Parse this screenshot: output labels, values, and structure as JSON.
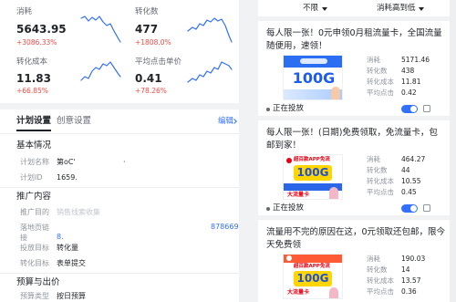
{
  "colors": {
    "accent": "#3370ff",
    "increase": "#f54a45",
    "toggle_on": "#3370ff",
    "status_dot": "#646a73"
  },
  "icons": {
    "sort_caret": "caret-down-icon",
    "edit_chevron": "chevron-right-icon",
    "card_action": "copy-icon",
    "carrier_logo": "unicom-logo-icon"
  },
  "metrics": [
    {
      "label": "消耗",
      "value": "5643.95",
      "change": "+3086.33%"
    },
    {
      "label": "转化数",
      "value": "477",
      "change": "+1808.0%"
    },
    {
      "label": "转化成本",
      "value": "11.83",
      "change": "+66.85%"
    },
    {
      "label": "平均点击单价",
      "value": "0.41",
      "change": "+78.26%"
    }
  ],
  "tabs": {
    "plan_settings": "计划设置",
    "creative_settings": "创意设置",
    "active_index": 0,
    "edit": "编辑"
  },
  "basic_info": {
    "title": "基本情况",
    "plan_name_label": "计划名称",
    "plan_name_value": "第oC'",
    "plan_name_tail": "·",
    "plan_id_label": "计划ID",
    "plan_id_value": "1659."
  },
  "promotion": {
    "title": "推广内容",
    "purpose_label": "推广目的",
    "purpose_value": "销售线索收集",
    "landing_label": "落地页链接",
    "landing_line1": "878669",
    "landing_line2": "8.",
    "goal_label": "投放目标",
    "goal_value": "转化量",
    "conversion_label": "转化目标",
    "conversion_value": "表单提交"
  },
  "budget": {
    "title": "预算与出价",
    "type_label": "预算类型",
    "type_value": "按日预算"
  },
  "filters": {
    "status": "不限",
    "sort": "消耗高到低"
  },
  "creatives": [
    {
      "title": "每人限一张！0元申领0月租流量卡，全国流量随便用，速领！",
      "image": {
        "headline": "100G"
      },
      "stats": [
        {
          "label": "消耗",
          "value": "5171.46"
        },
        {
          "label": "转化数",
          "value": "438"
        },
        {
          "label": "转化成本",
          "value": "11.81"
        },
        {
          "label": "平均点击",
          "value": "0.42"
        }
      ],
      "status": "正在投放",
      "enabled": true
    },
    {
      "title": "每人限一张！(日期)免费领取，免流量卡，包邮到家！",
      "image": {
        "tagline": "超百款APP免流",
        "headline": "100G",
        "badge": "大流量卡"
      },
      "stats": [
        {
          "label": "消耗",
          "value": "464.27"
        },
        {
          "label": "转化数",
          "value": "44"
        },
        {
          "label": "转化成本",
          "value": "10.55"
        },
        {
          "label": "平均点击",
          "value": "0.45"
        }
      ],
      "status": "正在投放",
      "enabled": true
    },
    {
      "title": "流量用不完的原因在这，0元领取还包邮，限今天免费领",
      "image": {
        "tagline": "超百款APP免流",
        "headline": "100G",
        "badge": "大流量卡"
      },
      "stats": [
        {
          "label": "消耗",
          "value": "190.03"
        },
        {
          "label": "转化数",
          "value": "14"
        },
        {
          "label": "转化成本",
          "value": "13.57"
        },
        {
          "label": "平均点击",
          "value": "0.36"
        }
      ]
    }
  ]
}
